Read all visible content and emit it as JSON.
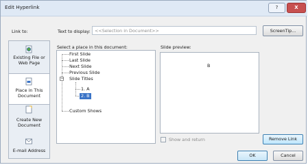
{
  "window": {
    "title": "Edit Hyperlink",
    "help_glyph": "?",
    "close_glyph": "X"
  },
  "link_to_label": "Link to:",
  "display": {
    "label": "Text to display:",
    "value": "<<Selection in Document>>"
  },
  "screentip_label": "ScreenTip...",
  "sidebar": {
    "items": [
      {
        "label_line1": "Existing File or",
        "label_line2": "Web Page",
        "icon": "file-web-icon"
      },
      {
        "label_line1": "Place in This",
        "label_line2": "Document",
        "icon": "place-in-document-icon"
      },
      {
        "label_line1": "Create New",
        "label_line2": "Document",
        "icon": "new-document-icon"
      },
      {
        "label_line1": "E-mail Address",
        "label_line2": "",
        "icon": "email-icon"
      }
    ]
  },
  "place_label": "Select a place in this document:",
  "tree": {
    "nodes": [
      "First Slide",
      "Last Slide",
      "Next Slide",
      "Previous Slide",
      "Slide Titles",
      "1. A",
      "2. B",
      "Custom Shows"
    ],
    "expander_glyph": "−"
  },
  "preview": {
    "label": "Slide preview:",
    "content": "B"
  },
  "show_return_label": "Show and return",
  "buttons": {
    "remove_link": "Remove Link",
    "ok": "OK",
    "cancel": "Cancel"
  }
}
